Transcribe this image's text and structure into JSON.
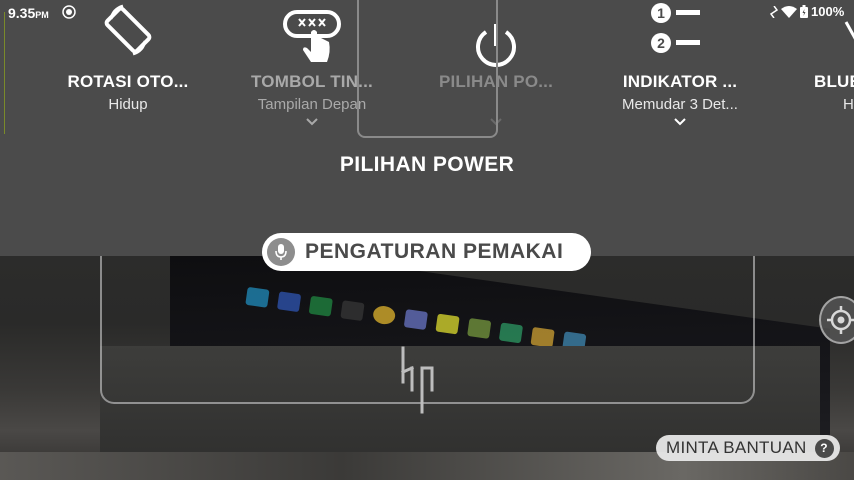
{
  "status_bar": {
    "time": "9.35",
    "ampm": "PM",
    "battery": "100%"
  },
  "quick_tiles": [
    {
      "title": "ROTASI OTO...",
      "subtitle": "Hidup",
      "icon": "screen-rotation-icon"
    },
    {
      "title": "TOMBOL TIN...",
      "subtitle": "Tampilan Depan",
      "icon": "touch-button-icon"
    },
    {
      "title": "PILIHAN PO...",
      "subtitle": "",
      "icon": "power-icon"
    },
    {
      "title": "INDIKATOR ...",
      "subtitle": "Memudar 3 Det...",
      "icon": "numbered-list-icon"
    },
    {
      "title": "BLUE",
      "subtitle": "H",
      "icon": "bluetooth-icon"
    }
  ],
  "focused_item_label": "PILIHAN POWER",
  "voice_button": {
    "label": "PENGATURAN PEMAKAI",
    "icon": "microphone-icon"
  },
  "help_button": {
    "label": "MINTA BANTUAN",
    "badge": "?"
  },
  "colors": {
    "panel": "#4b4b4b",
    "pill": "#ffffff",
    "focus_border": "#8a8a8a"
  }
}
